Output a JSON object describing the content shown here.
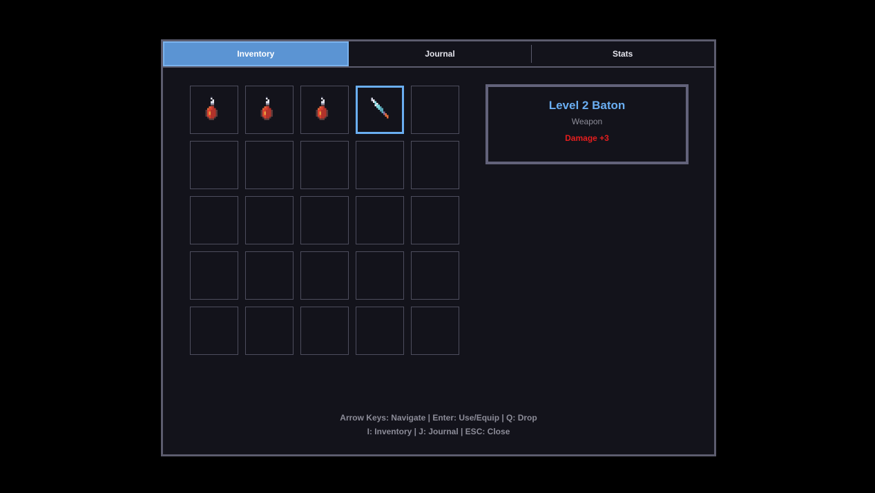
{
  "tabs": [
    {
      "label": "Inventory",
      "active": true
    },
    {
      "label": "Journal",
      "active": false
    },
    {
      "label": "Stats",
      "active": false
    }
  ],
  "inventory": {
    "slots": [
      {
        "item": "red-potion-icon"
      },
      {
        "item": "red-potion-icon"
      },
      {
        "item": "red-potion-icon"
      },
      {
        "item": "baton-weapon-icon",
        "selected": true
      },
      {
        "item": null
      },
      {
        "item": null
      },
      {
        "item": null
      },
      {
        "item": null
      },
      {
        "item": null
      },
      {
        "item": null
      },
      {
        "item": null
      },
      {
        "item": null
      },
      {
        "item": null
      },
      {
        "item": null
      },
      {
        "item": null
      },
      {
        "item": null
      },
      {
        "item": null
      },
      {
        "item": null
      },
      {
        "item": null
      },
      {
        "item": null
      },
      {
        "item": null
      },
      {
        "item": null
      },
      {
        "item": null
      },
      {
        "item": null
      },
      {
        "item": null
      }
    ]
  },
  "details": {
    "name": "Level 2 Baton",
    "type": "Weapon",
    "stat": "Damage +3"
  },
  "help": {
    "line1": "Arrow Keys: Navigate | Enter: Use/Equip | Q: Drop",
    "line2": "I: Inventory | J: Journal | ESC: Close"
  },
  "colors": {
    "accent": "#5b94d3",
    "selected_border": "#6aaef2",
    "stat_red": "#e61e1e",
    "panel_bg": "#13131b",
    "border": "#5c5c6e"
  }
}
